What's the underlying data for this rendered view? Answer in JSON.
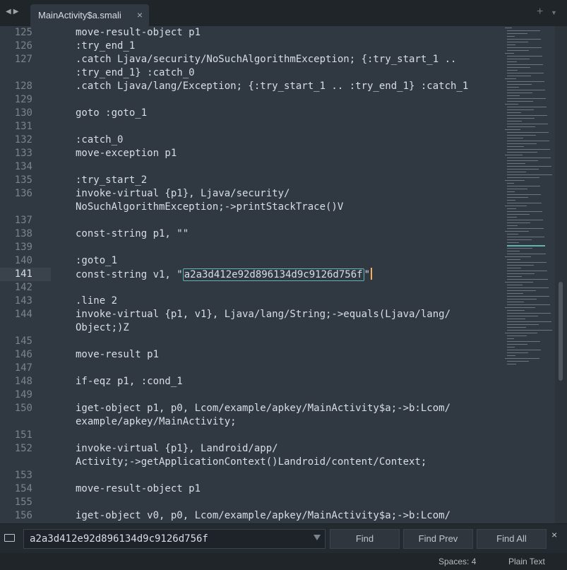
{
  "tab": {
    "label": "MainActivity$a.smali",
    "close": "×",
    "add": "+"
  },
  "editor": {
    "lines": [
      {
        "n": "125",
        "t": "move-result-object p1"
      },
      {
        "n": "126",
        "t": ":try_end_1"
      },
      {
        "n": "127",
        "t": ".catch Ljava/security/NoSuchAlgorithmException; {:try_start_1 .."
      },
      {
        "n": "",
        "t": ":try_end_1} :catch_0"
      },
      {
        "n": "128",
        "t": ".catch Ljava/lang/Exception; {:try_start_1 .. :try_end_1} :catch_1"
      },
      {
        "n": "129",
        "t": ""
      },
      {
        "n": "130",
        "t": "goto :goto_1"
      },
      {
        "n": "131",
        "t": ""
      },
      {
        "n": "132",
        "t": ":catch_0"
      },
      {
        "n": "133",
        "t": "move-exception p1"
      },
      {
        "n": "134",
        "t": ""
      },
      {
        "n": "135",
        "t": ":try_start_2"
      },
      {
        "n": "136",
        "t": "invoke-virtual {p1}, Ljava/security/"
      },
      {
        "n": "",
        "t": "NoSuchAlgorithmException;->printStackTrace()V"
      },
      {
        "n": "137",
        "t": ""
      },
      {
        "n": "138",
        "t": "const-string p1, \"\""
      },
      {
        "n": "139",
        "t": ""
      },
      {
        "n": "140",
        "t": ":goto_1"
      },
      {
        "n": "141",
        "t": "const-string v1, \"",
        "match": "a2a3d412e92d896134d9c9126d756f",
        "tail": "\"",
        "current": true
      },
      {
        "n": "142",
        "t": ""
      },
      {
        "n": "143",
        "t": ".line 2"
      },
      {
        "n": "144",
        "t": "invoke-virtual {p1, v1}, Ljava/lang/String;->equals(Ljava/lang/"
      },
      {
        "n": "",
        "t": "Object;)Z"
      },
      {
        "n": "145",
        "t": ""
      },
      {
        "n": "146",
        "t": "move-result p1"
      },
      {
        "n": "147",
        "t": ""
      },
      {
        "n": "148",
        "t": "if-eqz p1, :cond_1"
      },
      {
        "n": "149",
        "t": ""
      },
      {
        "n": "150",
        "t": "iget-object p1, p0, Lcom/example/apkey/MainActivity$a;->b:Lcom/"
      },
      {
        "n": "",
        "t": "example/apkey/MainActivity;"
      },
      {
        "n": "151",
        "t": ""
      },
      {
        "n": "152",
        "t": "invoke-virtual {p1}, Landroid/app/"
      },
      {
        "n": "",
        "t": "Activity;->getApplicationContext()Landroid/content/Context;"
      },
      {
        "n": "153",
        "t": ""
      },
      {
        "n": "154",
        "t": "move-result-object p1"
      },
      {
        "n": "155",
        "t": ""
      },
      {
        "n": "156",
        "t": "iget-object v0, p0, Lcom/example/apkey/MainActivity$a;->b:Lcom/"
      }
    ]
  },
  "find": {
    "value": "a2a3d412e92d896134d9c9126d756f",
    "find_label": "Find",
    "find_prev_label": "Find Prev",
    "find_all_label": "Find All",
    "close": "×"
  },
  "status": {
    "spaces": "Spaces: 4",
    "syntax": "Plain Text"
  },
  "colors": {
    "background": "#303841",
    "text": "#d8dee9",
    "highlight": "#5fb3b3",
    "caret": "#f9ae58"
  }
}
